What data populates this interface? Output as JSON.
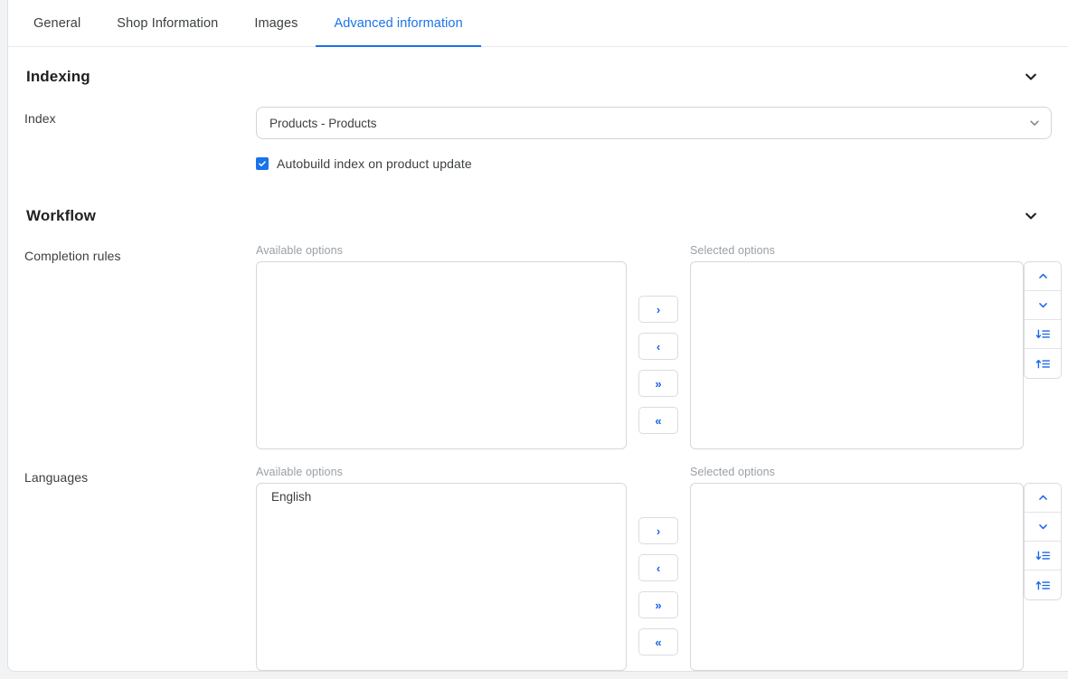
{
  "tabs": [
    {
      "label": "General",
      "active": false
    },
    {
      "label": "Shop Information",
      "active": false
    },
    {
      "label": "Images",
      "active": false
    },
    {
      "label": "Advanced information",
      "active": true
    }
  ],
  "colors": {
    "accent": "#1a73e8",
    "text": "#3c4043",
    "heading": "#202124",
    "muted": "#9aa0a6",
    "border": "#dadce0",
    "page_bg": "#f1f3f4"
  },
  "indexing": {
    "title": "Indexing",
    "collapse_icon": "chevron-down-icon",
    "index_field": {
      "label": "Index",
      "value": "Products - Products",
      "caret_icon": "chevron-down-icon"
    },
    "autobuild": {
      "label": "Autobuild index on product update",
      "checked": true
    }
  },
  "workflow": {
    "title": "Workflow",
    "collapse_icon": "chevron-down-icon",
    "transfer_buttons": [
      {
        "name": "move-right-button",
        "glyph": "›"
      },
      {
        "name": "move-left-button",
        "glyph": "‹"
      },
      {
        "name": "move-all-right-button",
        "glyph": "»"
      },
      {
        "name": "move-all-left-button",
        "glyph": "«"
      }
    ],
    "order_buttons": [
      {
        "name": "move-up-button",
        "icon": "chevron-up-icon"
      },
      {
        "name": "move-down-button",
        "icon": "chevron-down-icon"
      },
      {
        "name": "sort-descending-button",
        "icon": "sort-amount-down-icon"
      },
      {
        "name": "sort-ascending-button",
        "icon": "sort-amount-up-icon"
      }
    ],
    "rows": [
      {
        "label": "Completion rules",
        "available_caption": "Available options",
        "selected_caption": "Selected options",
        "available_items": [],
        "selected_items": []
      },
      {
        "label": "Languages",
        "available_caption": "Available options",
        "selected_caption": "Selected options",
        "available_items": [
          "English"
        ],
        "selected_items": []
      }
    ]
  }
}
